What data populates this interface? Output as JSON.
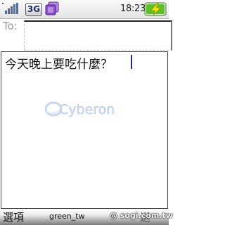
{
  "status_bar": {
    "network_type": "3G",
    "time": "18:23",
    "signal_icon": "signal-strength-icon",
    "multitask_icon": "multitask-icon",
    "battery_icon": "battery-charging-icon"
  },
  "recipient": {
    "label": "To:",
    "value": ""
  },
  "message": {
    "text": "今天晚上要吃什麼？",
    "watermark": "Cyberon"
  },
  "softkeys": {
    "left": "選項",
    "middle": "green_tw",
    "right": "送"
  },
  "watermark_site": "@ sogi.com.tw",
  "colors": {
    "cursor": "#1a2a9a",
    "watermark": "#c7d6ef",
    "multitask_purple": "#8a4fc8",
    "battery_green": "#3c9a1e"
  }
}
